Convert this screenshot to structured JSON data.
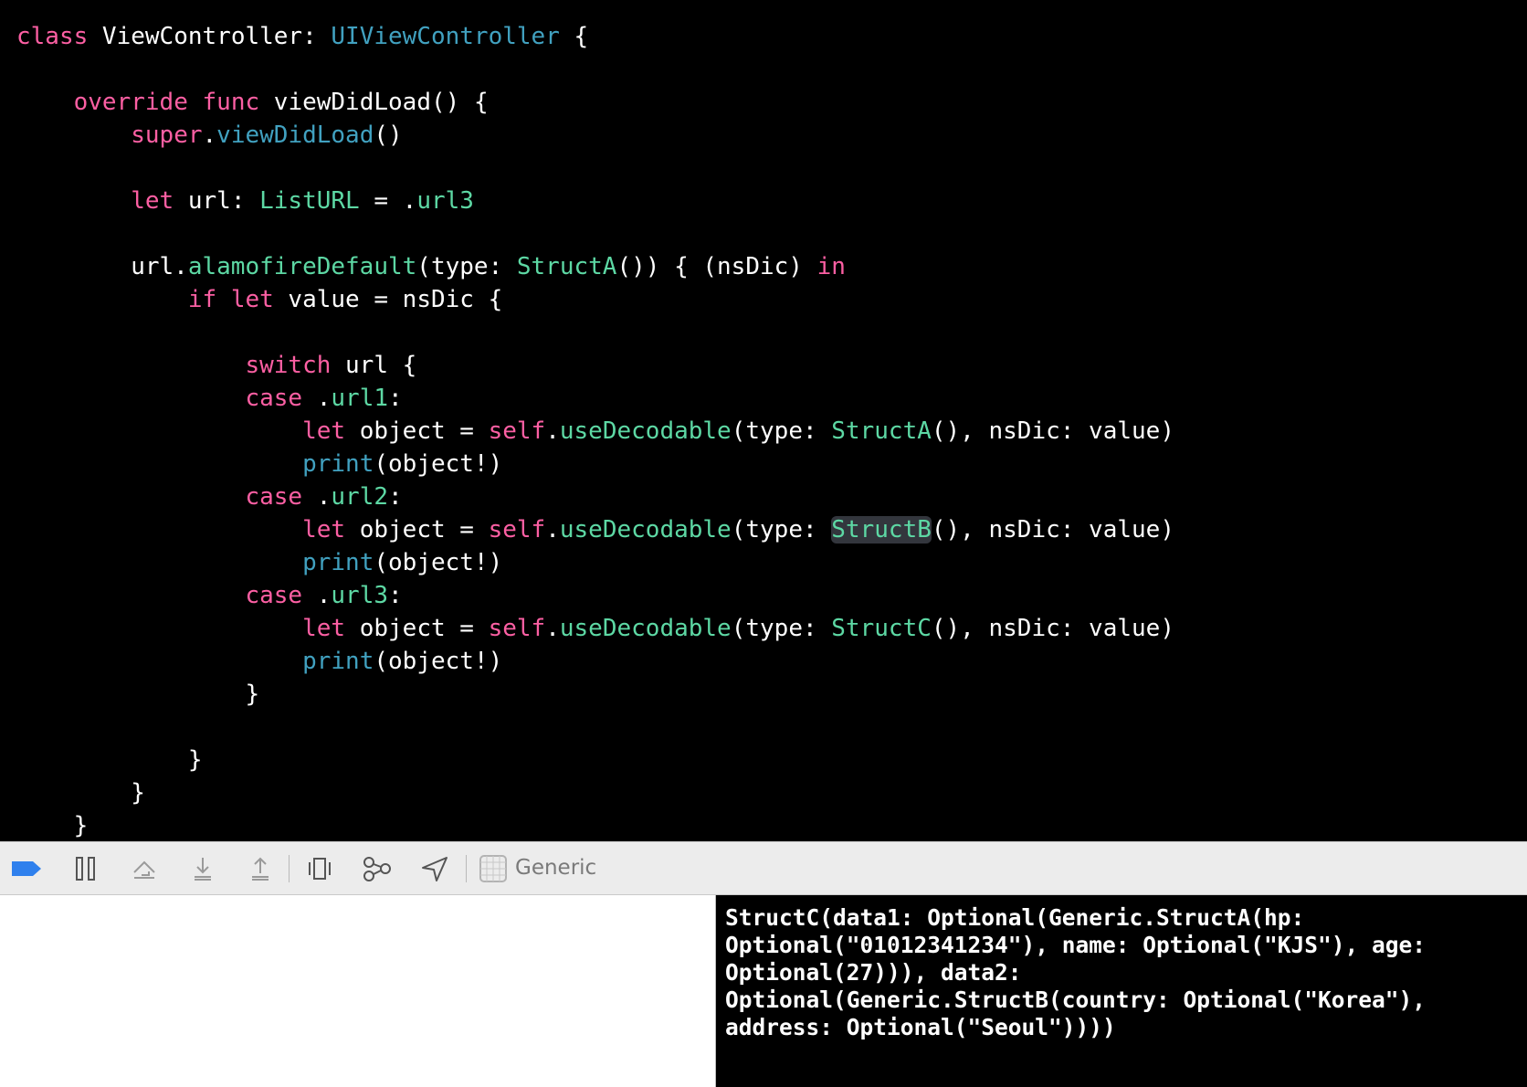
{
  "colors": {
    "keyword": "#fc5fa3",
    "project_type": "#5dd8a4",
    "system_type": "#41a1c0",
    "plain": "#ffffff",
    "debug_bar_bg": "#ececec",
    "breakpoint_blue": "#2f80ed",
    "console_text": "#ffffff"
  },
  "editor": {
    "lines": [
      [
        [
          "class",
          "k"
        ],
        [
          " ViewController: ",
          "p"
        ],
        [
          "UIViewController",
          "s"
        ],
        [
          " {",
          "p"
        ]
      ],
      [],
      [
        [
          "    ",
          "p"
        ],
        [
          "override",
          "k"
        ],
        [
          " ",
          "p"
        ],
        [
          "func",
          "k"
        ],
        [
          " viewDidLoad() {",
          "p"
        ]
      ],
      [
        [
          "        ",
          "p"
        ],
        [
          "super",
          "k"
        ],
        [
          ".",
          "p"
        ],
        [
          "viewDidLoad",
          "s"
        ],
        [
          "()",
          "p"
        ]
      ],
      [],
      [
        [
          "        ",
          "p"
        ],
        [
          "let",
          "k"
        ],
        [
          " url: ",
          "p"
        ],
        [
          "ListURL",
          "t"
        ],
        [
          " = .",
          "p"
        ],
        [
          "url3",
          "t"
        ]
      ],
      [],
      [
        [
          "        url.",
          "p"
        ],
        [
          "alamofireDefault",
          "t"
        ],
        [
          "(type: ",
          "p"
        ],
        [
          "StructA",
          "t"
        ],
        [
          "()) { (nsDic) ",
          "p"
        ],
        [
          "in",
          "k"
        ]
      ],
      [
        [
          "            ",
          "p"
        ],
        [
          "if",
          "k"
        ],
        [
          " ",
          "p"
        ],
        [
          "let",
          "k"
        ],
        [
          " value = nsDic {",
          "p"
        ]
      ],
      [],
      [
        [
          "                ",
          "p"
        ],
        [
          "switch",
          "k"
        ],
        [
          " url {",
          "p"
        ]
      ],
      [
        [
          "                ",
          "p"
        ],
        [
          "case",
          "k"
        ],
        [
          " .",
          "p"
        ],
        [
          "url1",
          "t"
        ],
        [
          ":",
          "p"
        ]
      ],
      [
        [
          "                    ",
          "p"
        ],
        [
          "let",
          "k"
        ],
        [
          " object = ",
          "p"
        ],
        [
          "self",
          "k"
        ],
        [
          ".",
          "p"
        ],
        [
          "useDecodable",
          "t"
        ],
        [
          "(type: ",
          "p"
        ],
        [
          "StructA",
          "t"
        ],
        [
          "(), nsDic: value)",
          "p"
        ]
      ],
      [
        [
          "                    ",
          "p"
        ],
        [
          "print",
          "s"
        ],
        [
          "(object!)",
          "p"
        ]
      ],
      [
        [
          "                ",
          "p"
        ],
        [
          "case",
          "k"
        ],
        [
          " .",
          "p"
        ],
        [
          "url2",
          "t"
        ],
        [
          ":",
          "p"
        ]
      ],
      [
        [
          "                    ",
          "p"
        ],
        [
          "let",
          "k"
        ],
        [
          " object = ",
          "p"
        ],
        [
          "self",
          "k"
        ],
        [
          ".",
          "p"
        ],
        [
          "useDecodable",
          "t"
        ],
        [
          "(type: ",
          "p"
        ],
        [
          "StructB",
          "t",
          "hl"
        ],
        [
          "(), nsDic: value)",
          "p"
        ]
      ],
      [
        [
          "                    ",
          "p"
        ],
        [
          "print",
          "s"
        ],
        [
          "(object!)",
          "p"
        ]
      ],
      [
        [
          "                ",
          "p"
        ],
        [
          "case",
          "k"
        ],
        [
          " .",
          "p"
        ],
        [
          "url3",
          "t"
        ],
        [
          ":",
          "p"
        ]
      ],
      [
        [
          "                    ",
          "p"
        ],
        [
          "let",
          "k"
        ],
        [
          " object = ",
          "p"
        ],
        [
          "self",
          "k"
        ],
        [
          ".",
          "p"
        ],
        [
          "useDecodable",
          "t"
        ],
        [
          "(type: ",
          "p"
        ],
        [
          "StructC",
          "t"
        ],
        [
          "(), nsDic: value)",
          "p"
        ]
      ],
      [
        [
          "                    ",
          "p"
        ],
        [
          "print",
          "s"
        ],
        [
          "(object!)",
          "p"
        ]
      ],
      [
        [
          "                }",
          "p"
        ]
      ],
      [],
      [
        [
          "            }",
          "p"
        ]
      ],
      [
        [
          "        }",
          "p"
        ]
      ],
      [
        [
          "    }",
          "p"
        ]
      ]
    ]
  },
  "debug_bar": {
    "icons": [
      "breakpoints-toggle-icon",
      "pause-icon",
      "step-over-icon",
      "step-into-icon",
      "step-out-icon",
      "view-hierarchy-icon",
      "memory-graph-icon",
      "simulate-location-icon",
      "device-icon"
    ],
    "target_label": "Generic"
  },
  "console": {
    "output": "StructC(data1: Optional(Generic.StructA(hp:\nOptional(\"01012341234\"), name: Optional(\"KJS\"), age:\nOptional(27))), data2:\nOptional(Generic.StructB(country: Optional(\"Korea\"),\naddress: Optional(\"Seoul\"))))"
  }
}
